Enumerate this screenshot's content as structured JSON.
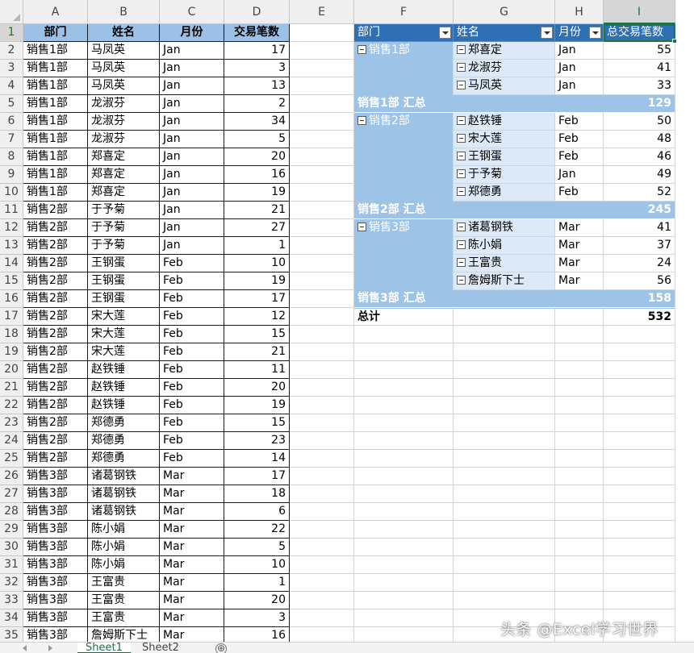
{
  "columns": [
    "A",
    "B",
    "C",
    "D",
    "E",
    "F",
    "G",
    "H",
    "I"
  ],
  "selected_column": "I",
  "selected_row": 1,
  "source_table": {
    "headers": [
      "部门",
      "姓名",
      "月份",
      "交易笔数"
    ],
    "rows": [
      [
        "销售1部",
        "马凤英",
        "Jan",
        "17"
      ],
      [
        "销售1部",
        "马凤英",
        "Jan",
        "3"
      ],
      [
        "销售1部",
        "马凤英",
        "Jan",
        "13"
      ],
      [
        "销售1部",
        "龙淑芬",
        "Jan",
        "2"
      ],
      [
        "销售1部",
        "龙淑芬",
        "Jan",
        "34"
      ],
      [
        "销售1部",
        "龙淑芬",
        "Jan",
        "5"
      ],
      [
        "销售1部",
        "郑喜定",
        "Jan",
        "20"
      ],
      [
        "销售1部",
        "郑喜定",
        "Jan",
        "16"
      ],
      [
        "销售1部",
        "郑喜定",
        "Jan",
        "19"
      ],
      [
        "销售2部",
        "于予菊",
        "Jan",
        "21"
      ],
      [
        "销售2部",
        "于予菊",
        "Jan",
        "27"
      ],
      [
        "销售2部",
        "于予菊",
        "Jan",
        "1"
      ],
      [
        "销售2部",
        "王钢蛋",
        "Feb",
        "10"
      ],
      [
        "销售2部",
        "王钢蛋",
        "Feb",
        "19"
      ],
      [
        "销售2部",
        "王钢蛋",
        "Feb",
        "17"
      ],
      [
        "销售2部",
        "宋大莲",
        "Feb",
        "12"
      ],
      [
        "销售2部",
        "宋大莲",
        "Feb",
        "15"
      ],
      [
        "销售2部",
        "宋大莲",
        "Feb",
        "21"
      ],
      [
        "销售2部",
        "赵铁锤",
        "Feb",
        "11"
      ],
      [
        "销售2部",
        "赵铁锤",
        "Feb",
        "20"
      ],
      [
        "销售2部",
        "赵铁锤",
        "Feb",
        "19"
      ],
      [
        "销售2部",
        "郑德勇",
        "Feb",
        "15"
      ],
      [
        "销售2部",
        "郑德勇",
        "Feb",
        "23"
      ],
      [
        "销售2部",
        "郑德勇",
        "Feb",
        "14"
      ],
      [
        "销售3部",
        "诸葛钢铁",
        "Mar",
        "17"
      ],
      [
        "销售3部",
        "诸葛钢铁",
        "Mar",
        "18"
      ],
      [
        "销售3部",
        "诸葛钢铁",
        "Mar",
        "6"
      ],
      [
        "销售3部",
        "陈小娟",
        "Mar",
        "22"
      ],
      [
        "销售3部",
        "陈小娟",
        "Mar",
        "5"
      ],
      [
        "销售3部",
        "陈小娟",
        "Mar",
        "10"
      ],
      [
        "销售3部",
        "王富贵",
        "Mar",
        "1"
      ],
      [
        "销售3部",
        "王富贵",
        "Mar",
        "20"
      ],
      [
        "销售3部",
        "王富贵",
        "Mar",
        "3"
      ],
      [
        "销售3部",
        "詹姆斯下士",
        "Mar",
        "16"
      ]
    ]
  },
  "pivot": {
    "headers": [
      "部门",
      "姓名",
      "月份",
      "总交易笔数"
    ],
    "groups": [
      {
        "dept": "销售1部",
        "rows": [
          [
            "郑喜定",
            "Jan",
            "55"
          ],
          [
            "龙淑芬",
            "Jan",
            "41"
          ],
          [
            "马凤英",
            "Jan",
            "33"
          ]
        ],
        "subtotal_label": "销售1部 汇总",
        "subtotal": "129"
      },
      {
        "dept": "销售2部",
        "rows": [
          [
            "赵铁锤",
            "Feb",
            "50"
          ],
          [
            "宋大莲",
            "Feb",
            "48"
          ],
          [
            "王钢蛋",
            "Feb",
            "46"
          ],
          [
            "于予菊",
            "Jan",
            "49"
          ],
          [
            "郑德勇",
            "Feb",
            "52"
          ]
        ],
        "subtotal_label": "销售2部 汇总",
        "subtotal": "245"
      },
      {
        "dept": "销售3部",
        "rows": [
          [
            "诸葛钢铁",
            "Mar",
            "41"
          ],
          [
            "陈小娟",
            "Mar",
            "37"
          ],
          [
            "王富贵",
            "Mar",
            "24"
          ],
          [
            "詹姆斯下士",
            "Mar",
            "56"
          ]
        ],
        "subtotal_label": "销售3部 汇总",
        "subtotal": "158"
      }
    ],
    "grand_total_label": "总计",
    "grand_total": "532"
  },
  "sheet_tabs": [
    "Sheet1",
    "Sheet2"
  ],
  "active_sheet": "Sheet1",
  "add_sheet_symbol": "⊕",
  "watermark": "头条 @Excel学习世界",
  "colors": {
    "header_fill": "#9bc2e6",
    "pivot_header": "#2f6fb4",
    "pivot_dept": "#9dc3e6",
    "pivot_name": "#dde9f6",
    "excel_green": "#217346"
  }
}
